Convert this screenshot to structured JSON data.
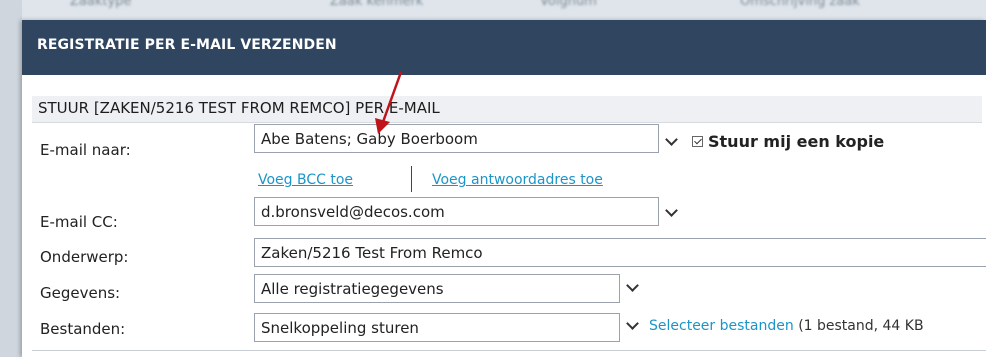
{
  "dialog": {
    "title": "REGISTRATIE PER E-MAIL VERZENDEN",
    "subtitle": "STUUR [ZAKEN/5216 TEST FROM REMCO] PER E-MAIL"
  },
  "form": {
    "to": {
      "label": "E-mail naar:",
      "value": "Abe Batens;   Gaby Boerboom"
    },
    "copy_self": {
      "label": "Stuur mij een kopie",
      "checked": true
    },
    "bcc_link": "Voeg BCC toe",
    "reply_link": "Voeg antwoordadres toe",
    "cc": {
      "label": "E-mail CC:",
      "value": "d.bronsveld@decos.com"
    },
    "subject": {
      "label": "Onderwerp:",
      "value": "Zaken/5216 Test From Remco"
    },
    "data": {
      "label": "Gegevens:",
      "value": "Alle registratiegegevens"
    },
    "files": {
      "label": "Bestanden:",
      "value": "Snelkoppeling sturen",
      "select_link": "Selecteer bestanden",
      "summary": "(1 bestand, 44 KB"
    }
  },
  "colors": {
    "header_bg": "#2f4560",
    "link": "#1b95c8",
    "annotation_arrow": "#c0141b"
  },
  "icons": [
    "chevron-down-icon",
    "checkbox-icon",
    "red-arrow-annotation"
  ]
}
